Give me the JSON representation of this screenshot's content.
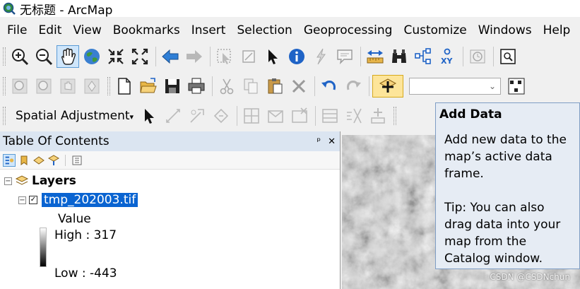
{
  "window": {
    "title": "无标题 - ArcMap"
  },
  "menu": [
    "File",
    "Edit",
    "View",
    "Bookmarks",
    "Insert",
    "Selection",
    "Geoprocessing",
    "Customize",
    "Windows",
    "Help"
  ],
  "spatial_adjustment": {
    "label": "Spatial Adjustment",
    "arrow": "▾"
  },
  "toc": {
    "title": "Table Of Contents",
    "pin": "ᵖ",
    "close": "✕",
    "root": {
      "expander": "−",
      "label": "Layers"
    },
    "layer": {
      "expander": "−",
      "check": "✓",
      "name": "tmp_202003.tif"
    },
    "legend": {
      "heading": "Value",
      "high": "High : 317",
      "low": "Low : -443"
    }
  },
  "tooltip": {
    "title": "Add Data",
    "body": "Add new data to the map’s active data frame.",
    "tip": "Tip: You can also drag data into your map from the Catalog window."
  },
  "watermark": "CSDN @CSDNchun",
  "colors": {
    "accent": "#0a64d1",
    "tooltip_bg": "#e6ecf4",
    "highlight": "#fde59a"
  }
}
